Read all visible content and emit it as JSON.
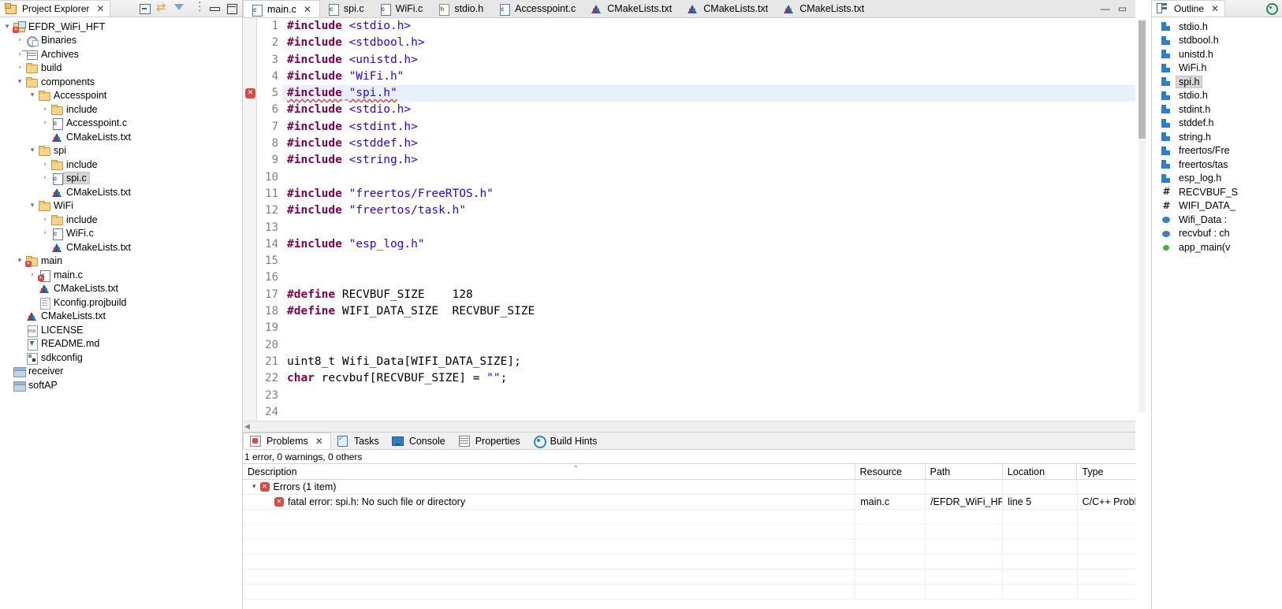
{
  "project_explorer": {
    "title": "Project Explorer",
    "close_label": "✕",
    "toolbar": [
      {
        "name": "collapse-all-icon"
      },
      {
        "name": "link-with-editor-icon"
      },
      {
        "name": "filter-icon"
      },
      {
        "name": "view-menu-icon"
      },
      {
        "name": "minimize-icon"
      },
      {
        "name": "maximize-icon"
      }
    ],
    "tree": [
      {
        "label": "EFDR_WiFi_HFT",
        "indent": 0,
        "arrow": "▾",
        "icon": "project-icon",
        "error": true
      },
      {
        "label": "Binaries",
        "indent": 1,
        "arrow": "›",
        "icon": "binaries-icon"
      },
      {
        "label": "Archives",
        "indent": 1,
        "arrow": "›",
        "icon": "archives-icon"
      },
      {
        "label": "build",
        "indent": 1,
        "arrow": "›",
        "icon": "folder-icon"
      },
      {
        "label": "components",
        "indent": 1,
        "arrow": "▾",
        "icon": "folder-icon"
      },
      {
        "label": "Accesspoint",
        "indent": 2,
        "arrow": "▾",
        "icon": "folder-icon"
      },
      {
        "label": "include",
        "indent": 3,
        "arrow": "›",
        "icon": "folder-icon"
      },
      {
        "label": "Accesspoint.c",
        "indent": 3,
        "arrow": "›",
        "icon": "c-file-icon"
      },
      {
        "label": "CMakeLists.txt",
        "indent": 3,
        "arrow": "",
        "icon": "cmake-file-icon"
      },
      {
        "label": "spi",
        "indent": 2,
        "arrow": "▾",
        "icon": "folder-icon"
      },
      {
        "label": "include",
        "indent": 3,
        "arrow": "›",
        "icon": "folder-icon"
      },
      {
        "label": "spi.c",
        "indent": 3,
        "arrow": "›",
        "icon": "c-file-icon",
        "selected": true
      },
      {
        "label": "CMakeLists.txt",
        "indent": 3,
        "arrow": "",
        "icon": "cmake-file-icon"
      },
      {
        "label": "WiFi",
        "indent": 2,
        "arrow": "▾",
        "icon": "folder-icon"
      },
      {
        "label": "include",
        "indent": 3,
        "arrow": "›",
        "icon": "folder-icon"
      },
      {
        "label": "WiFi.c",
        "indent": 3,
        "arrow": "›",
        "icon": "c-file-icon"
      },
      {
        "label": "CMakeLists.txt",
        "indent": 3,
        "arrow": "",
        "icon": "cmake-file-icon"
      },
      {
        "label": "main",
        "indent": 1,
        "arrow": "▾",
        "icon": "folder-icon",
        "error": true
      },
      {
        "label": "main.c",
        "indent": 2,
        "arrow": "›",
        "icon": "c-file-icon",
        "error": true
      },
      {
        "label": "CMakeLists.txt",
        "indent": 2,
        "arrow": "",
        "icon": "cmake-file-icon"
      },
      {
        "label": "Kconfig.projbuild",
        "indent": 2,
        "arrow": "",
        "icon": "document-icon"
      },
      {
        "label": "CMakeLists.txt",
        "indent": 1,
        "arrow": "",
        "icon": "cmake-file-icon"
      },
      {
        "label": "LICENSE",
        "indent": 1,
        "arrow": "",
        "icon": "license-icon"
      },
      {
        "label": "README.md",
        "indent": 1,
        "arrow": "",
        "icon": "markdown-icon"
      },
      {
        "label": "sdkconfig",
        "indent": 1,
        "arrow": "",
        "icon": "config-icon"
      },
      {
        "label": "receiver",
        "indent": 0,
        "arrow": "",
        "icon": "closed-project-icon"
      },
      {
        "label": "softAP",
        "indent": 0,
        "arrow": "",
        "icon": "closed-project-icon"
      }
    ]
  },
  "editor": {
    "tabs": [
      {
        "label": "main.c",
        "icon": "c-file-icon",
        "active": true,
        "close": "✕"
      },
      {
        "label": "spi.c",
        "icon": "c-file-icon",
        "active": false
      },
      {
        "label": "WiFi.c",
        "icon": "c-file-icon",
        "active": false
      },
      {
        "label": "stdio.h",
        "icon": "h-file-icon",
        "active": false
      },
      {
        "label": "Accesspoint.c",
        "icon": "c-file-icon",
        "active": false
      },
      {
        "label": "CMakeLists.txt",
        "icon": "cmake-file-icon",
        "active": false
      },
      {
        "label": "CMakeLists.txt",
        "icon": "cmake-file-icon",
        "active": false
      },
      {
        "label": "CMakeLists.txt",
        "icon": "cmake-file-icon",
        "active": false
      }
    ],
    "window_controls": {
      "minimize": "—",
      "maximize": "▭",
      "restore": "❐"
    },
    "error_marker_glyph": "✕",
    "error_marker_line": 5,
    "highlighted_line": 5,
    "first_line": 1,
    "lines": [
      {
        "n": "1",
        "tokens": [
          {
            "t": "#include",
            "c": "pp"
          },
          {
            "t": " ",
            "c": "plain"
          },
          {
            "t": "<stdio.h>",
            "c": "str"
          }
        ]
      },
      {
        "n": "2",
        "tokens": [
          {
            "t": "#include",
            "c": "pp"
          },
          {
            "t": " ",
            "c": "plain"
          },
          {
            "t": "<stdbool.h>",
            "c": "str"
          }
        ]
      },
      {
        "n": "3",
        "tokens": [
          {
            "t": "#include",
            "c": "pp"
          },
          {
            "t": " ",
            "c": "plain"
          },
          {
            "t": "<unistd.h>",
            "c": "str"
          }
        ]
      },
      {
        "n": "4",
        "tokens": [
          {
            "t": "#include",
            "c": "pp"
          },
          {
            "t": " ",
            "c": "plain"
          },
          {
            "t": "\"WiFi.h\"",
            "c": "str"
          }
        ]
      },
      {
        "n": "5",
        "hl": true,
        "err": true,
        "tokens": [
          {
            "t": "#include",
            "c": "pp sq"
          },
          {
            "t": " ",
            "c": "plain sq"
          },
          {
            "t": "\"spi.h\"",
            "c": "str sq"
          }
        ]
      },
      {
        "n": "6",
        "tokens": [
          {
            "t": "#include",
            "c": "pp"
          },
          {
            "t": " ",
            "c": "plain"
          },
          {
            "t": "<stdio.h>",
            "c": "str"
          }
        ]
      },
      {
        "n": "7",
        "tokens": [
          {
            "t": "#include",
            "c": "pp"
          },
          {
            "t": " ",
            "c": "plain"
          },
          {
            "t": "<stdint.h>",
            "c": "str"
          }
        ]
      },
      {
        "n": "8",
        "tokens": [
          {
            "t": "#include",
            "c": "pp"
          },
          {
            "t": " ",
            "c": "plain"
          },
          {
            "t": "<stddef.h>",
            "c": "str"
          }
        ]
      },
      {
        "n": "9",
        "tokens": [
          {
            "t": "#include",
            "c": "pp"
          },
          {
            "t": " ",
            "c": "plain"
          },
          {
            "t": "<string.h>",
            "c": "str"
          }
        ]
      },
      {
        "n": "10",
        "tokens": []
      },
      {
        "n": "11",
        "tokens": [
          {
            "t": "#include",
            "c": "pp"
          },
          {
            "t": " ",
            "c": "plain"
          },
          {
            "t": "\"freertos/FreeRTOS.h\"",
            "c": "str"
          }
        ]
      },
      {
        "n": "12",
        "tokens": [
          {
            "t": "#include",
            "c": "pp"
          },
          {
            "t": " ",
            "c": "plain"
          },
          {
            "t": "\"freertos/task.h\"",
            "c": "str"
          }
        ]
      },
      {
        "n": "13",
        "tokens": []
      },
      {
        "n": "14",
        "tokens": [
          {
            "t": "#include",
            "c": "pp"
          },
          {
            "t": " ",
            "c": "plain"
          },
          {
            "t": "\"esp_log.h\"",
            "c": "str"
          }
        ]
      },
      {
        "n": "15",
        "tokens": []
      },
      {
        "n": "16",
        "tokens": []
      },
      {
        "n": "17",
        "tokens": [
          {
            "t": "#define",
            "c": "pp"
          },
          {
            "t": " RECVBUF_SIZE    128",
            "c": "plain"
          }
        ]
      },
      {
        "n": "18",
        "tokens": [
          {
            "t": "#define",
            "c": "pp"
          },
          {
            "t": " WIFI_DATA_SIZE  RECVBUF_SIZE",
            "c": "plain"
          }
        ]
      },
      {
        "n": "19",
        "tokens": []
      },
      {
        "n": "20",
        "tokens": []
      },
      {
        "n": "21",
        "tokens": [
          {
            "t": "uint8_t",
            "c": "plain"
          },
          {
            "t": " Wifi_Data[WIFI_DATA_SIZE];",
            "c": "plain"
          }
        ]
      },
      {
        "n": "22",
        "tokens": [
          {
            "t": "char",
            "c": "kw"
          },
          {
            "t": " recvbuf[RECVBUF_SIZE] = ",
            "c": "plain"
          },
          {
            "t": "\"\"",
            "c": "str"
          },
          {
            "t": ";",
            "c": "plain"
          }
        ]
      },
      {
        "n": "23",
        "tokens": []
      },
      {
        "n": "24",
        "tokens": []
      }
    ],
    "hscroll": {
      "left_arrow": "◀",
      "right_arrow": "▶"
    }
  },
  "problems": {
    "tabs": [
      {
        "label": "Problems",
        "icon": "problems-icon",
        "active": true,
        "close": "✕"
      },
      {
        "label": "Tasks",
        "icon": "tasks-icon",
        "active": false
      },
      {
        "label": "Console",
        "icon": "console-icon",
        "active": false
      },
      {
        "label": "Properties",
        "icon": "properties-icon",
        "active": false
      },
      {
        "label": "Build Hints",
        "icon": "build-hints-icon",
        "active": false
      }
    ],
    "summary": "1 error, 0 warnings, 0 others",
    "columns": [
      "Description",
      "Resource",
      "Path",
      "Location",
      "Type"
    ],
    "sort_indicator": "⌃",
    "group": {
      "label": "Errors (1 item)",
      "arrow": "▾",
      "icon": "error-icon"
    },
    "rows": [
      {
        "description": "fatal error: spi.h: No such file or directory",
        "resource": "main.c",
        "path": "/EFDR_WiFi_HFT/m...",
        "location": "line 5",
        "type": "C/C++ Probl...",
        "icon": "error-icon"
      }
    ],
    "empty_row_count": 6
  },
  "outline": {
    "title": "Outline",
    "close_label": "✕",
    "menu_icon": "target-icon",
    "items": [
      {
        "label": "stdio.h",
        "icon": "include-icon"
      },
      {
        "label": "stdbool.h",
        "icon": "include-icon"
      },
      {
        "label": "unistd.h",
        "icon": "include-icon"
      },
      {
        "label": "WiFi.h",
        "icon": "include-icon"
      },
      {
        "label": "spi.h",
        "icon": "include-icon",
        "selected": true
      },
      {
        "label": "stdio.h",
        "icon": "include-icon"
      },
      {
        "label": "stdint.h",
        "icon": "include-icon"
      },
      {
        "label": "stddef.h",
        "icon": "include-icon"
      },
      {
        "label": "string.h",
        "icon": "include-icon"
      },
      {
        "label": "freertos/Fre",
        "icon": "include-icon"
      },
      {
        "label": "freertos/tas",
        "icon": "include-icon"
      },
      {
        "label": "esp_log.h",
        "icon": "include-icon"
      },
      {
        "label": "RECVBUF_S",
        "icon": "define-icon"
      },
      {
        "label": "WIFI_DATA_",
        "icon": "define-icon"
      },
      {
        "label": "Wifi_Data :",
        "icon": "variable-icon"
      },
      {
        "label": "recvbuf : ch",
        "icon": "variable-icon"
      },
      {
        "label": "app_main(v",
        "icon": "function-icon"
      }
    ]
  },
  "colors": {
    "error": "#d94b45",
    "keyword": "#7f0055",
    "string": "#2a00ff",
    "selection": "#e8f1fb",
    "tree_selection": "#d8d8d8",
    "overview_marker": "#ff1e8e"
  }
}
